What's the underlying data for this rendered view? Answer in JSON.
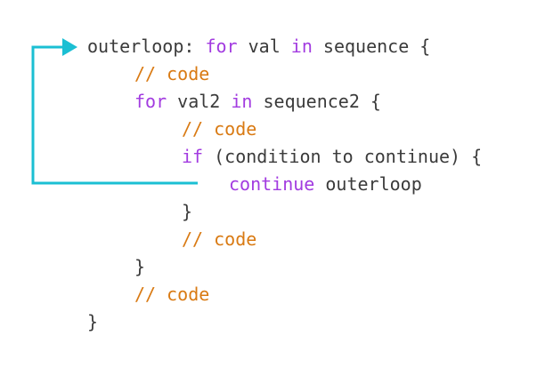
{
  "colors": {
    "keyword": "#a23be0",
    "comment": "#d97a13",
    "text": "#3b3b3b",
    "arrow": "#1bbfd3"
  },
  "lines": [
    {
      "indent": 0,
      "tokens": [
        {
          "type": "tx",
          "text": "outerloop: "
        },
        {
          "type": "kw",
          "text": "for"
        },
        {
          "type": "tx",
          "text": " val "
        },
        {
          "type": "kw",
          "text": "in"
        },
        {
          "type": "tx",
          "text": " sequence {"
        }
      ]
    },
    {
      "indent": 1,
      "tokens": [
        {
          "type": "cm",
          "text": "// code"
        }
      ]
    },
    {
      "indent": 1,
      "tokens": [
        {
          "type": "kw",
          "text": "for"
        },
        {
          "type": "tx",
          "text": " val2 "
        },
        {
          "type": "kw",
          "text": "in"
        },
        {
          "type": "tx",
          "text": " sequence2 {"
        }
      ]
    },
    {
      "indent": 2,
      "tokens": [
        {
          "type": "cm",
          "text": "// code"
        }
      ]
    },
    {
      "indent": 2,
      "tokens": [
        {
          "type": "kw",
          "text": "if"
        },
        {
          "type": "tx",
          "text": " (condition to continue) {"
        }
      ]
    },
    {
      "indent": 3,
      "tokens": [
        {
          "type": "kw",
          "text": "continue"
        },
        {
          "type": "tx",
          "text": " outerloop"
        }
      ]
    },
    {
      "indent": 2,
      "tokens": [
        {
          "type": "tx",
          "text": "}"
        }
      ]
    },
    {
      "indent": 2,
      "tokens": [
        {
          "type": "cm",
          "text": "// code"
        }
      ]
    },
    {
      "indent": 1,
      "tokens": [
        {
          "type": "tx",
          "text": "}"
        }
      ]
    },
    {
      "indent": 1,
      "tokens": [
        {
          "type": "cm",
          "text": "// code"
        }
      ]
    },
    {
      "indent": 0,
      "tokens": [
        {
          "type": "tx",
          "text": "}"
        }
      ]
    }
  ]
}
